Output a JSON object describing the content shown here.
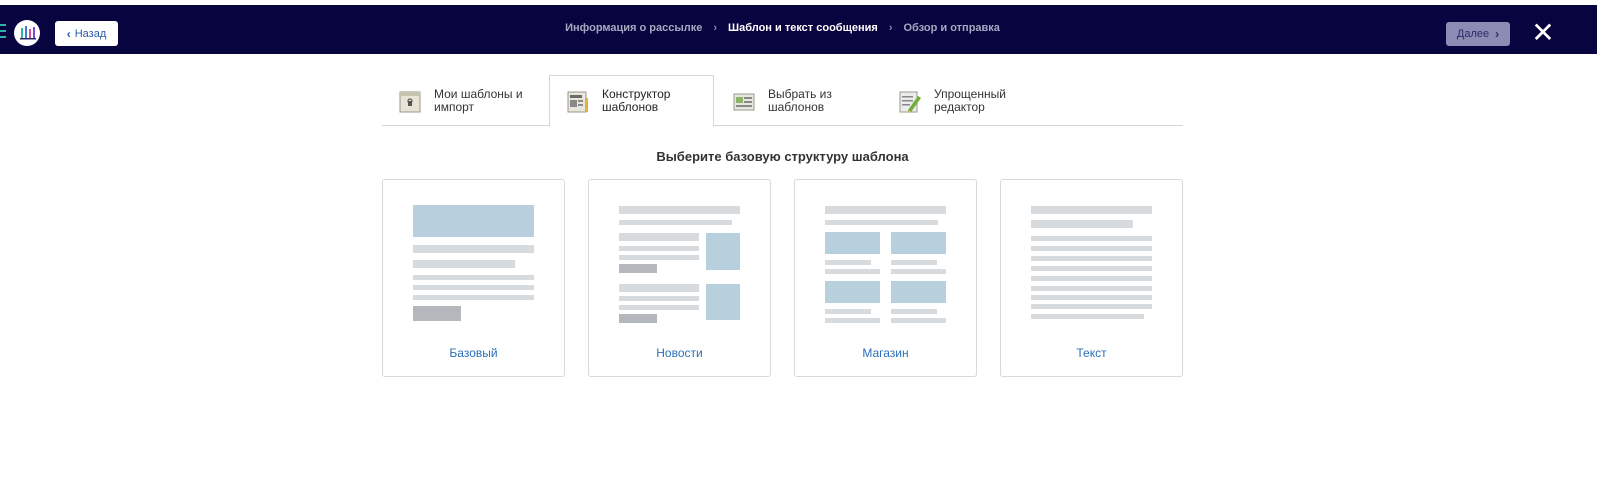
{
  "header": {
    "back_label": "Назад",
    "next_label": "Далее",
    "steps": [
      {
        "label": "Информация о рассылке",
        "state": "done"
      },
      {
        "label": "Шаблон и текст сообщения",
        "state": "active"
      },
      {
        "label": "Обзор и отправка",
        "state": "pending"
      }
    ],
    "step_separator": "›",
    "close_glyph": "✕"
  },
  "tabs": [
    {
      "label": "Мои шаблоны и импорт",
      "icon": "folder-import-icon",
      "active": false
    },
    {
      "label": "Конструктор шаблонов",
      "icon": "template-builder-icon",
      "active": true
    },
    {
      "label": "Выбрать из шаблонов",
      "icon": "template-gallery-icon",
      "active": false
    },
    {
      "label": "Упрощенный редактор",
      "icon": "pencil-editor-icon",
      "active": false
    }
  ],
  "heading": "Выберите базовую структуру шаблона",
  "cards": [
    {
      "label": "Базовый",
      "layout": "basic"
    },
    {
      "label": "Новости",
      "layout": "news"
    },
    {
      "label": "Магазин",
      "layout": "shop"
    },
    {
      "label": "Текст",
      "layout": "text"
    }
  ],
  "colors": {
    "header_bg": "#07043f",
    "accent_teal": "#2fb5a3",
    "link_blue": "#2a6fb8",
    "preview_block": "#b8d0de",
    "preview_line": "#d8dbdd",
    "preview_button": "#b4b8bc"
  }
}
